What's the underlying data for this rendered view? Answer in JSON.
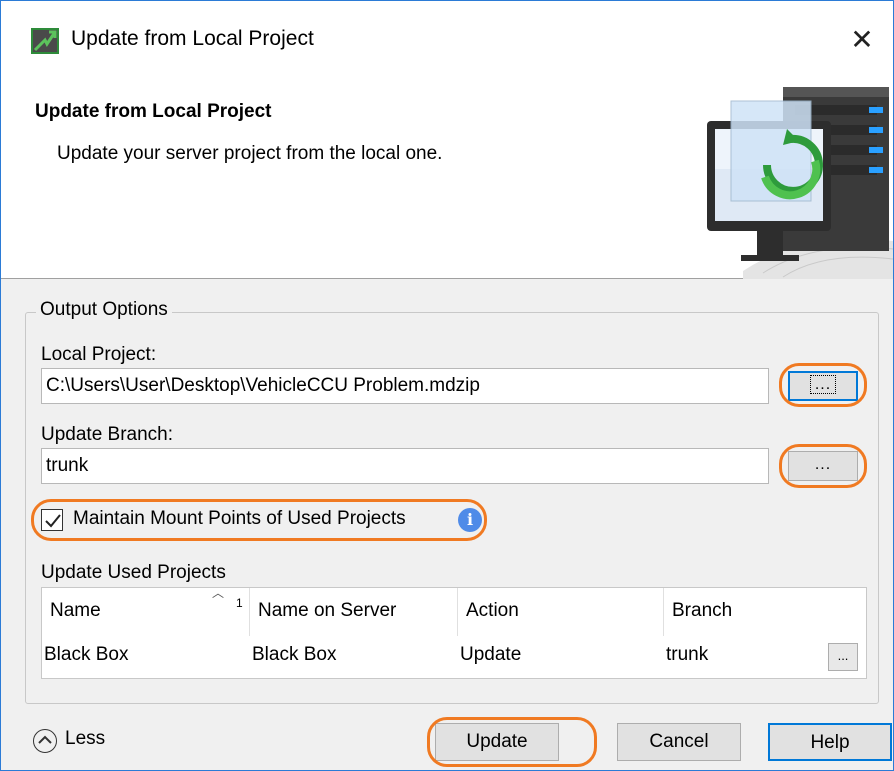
{
  "window": {
    "title": "Update from Local Project",
    "close_glyph": "✕",
    "app_icon": "magicdraw-app-icon"
  },
  "banner": {
    "title": "Update from Local Project",
    "subtitle": "Update your server project from the local one.",
    "illustration": "server-sync-illustration"
  },
  "group": {
    "legend": "Output Options",
    "local_project_label": "Local Project:",
    "local_project_value": "C:\\Users\\User\\Desktop\\VehicleCCU Problem.mdzip",
    "update_branch_label": "Update Branch:",
    "update_branch_value": "trunk",
    "browse_label": "...",
    "maintain_mount_points_label": "Maintain Mount Points of Used Projects",
    "maintain_mount_points_checked": true,
    "info_glyph": "i",
    "used_projects_label": "Update Used Projects"
  },
  "table": {
    "columns": [
      "Name",
      "Name on Server",
      "Action",
      "Branch"
    ],
    "sort_indicator": "1",
    "rows": [
      {
        "name": "Black Box",
        "name_on_server": "Black Box",
        "action": "Update",
        "branch": "trunk",
        "cell_button": "..."
      }
    ]
  },
  "footer": {
    "less_label": "Less",
    "update_label": "Update",
    "cancel_label": "Cancel",
    "help_label": "Help"
  },
  "colors": {
    "highlight": "#f07a22",
    "accent": "#0078d7",
    "info": "#4f8be8"
  }
}
